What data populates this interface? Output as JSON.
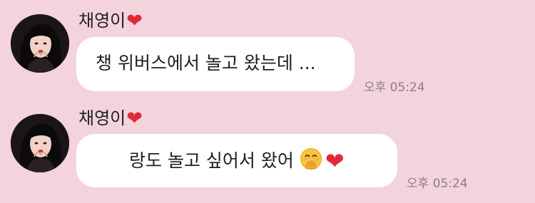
{
  "messages": [
    {
      "sender": "채영이",
      "sender_heart": "❤",
      "text": "챙 위버스에서 놀고 왔는데 ...",
      "time": "오후 05:24"
    },
    {
      "sender": "채영이",
      "sender_heart": "❤",
      "text": "랑도 놀고 싶어서 왔어",
      "emoji_face": "hand-over-mouth-face-icon",
      "emoji_heart": "❤",
      "time": "오후 05:24"
    }
  ],
  "colors": {
    "background": "#f3d3dc",
    "bubble": "#ffffff",
    "heart": "#e02a3a",
    "time": "#8c8088"
  }
}
